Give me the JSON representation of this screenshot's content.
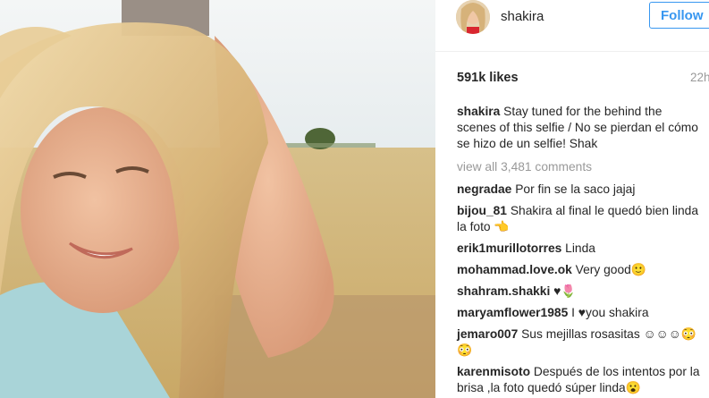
{
  "post": {
    "author": "shakira",
    "follow_label": "Follow",
    "likes": "591k likes",
    "time": "22h",
    "caption": {
      "user": "shakira",
      "text": "Stay tuned for the behind the scenes of this selfie / No se pierdan el cómo se hizo de un selfie! Shak"
    },
    "view_all": "view all 3,481 comments"
  },
  "comments": [
    {
      "user": "negradae",
      "text": "Por fin se la saco jajaj"
    },
    {
      "user": "bijou_81",
      "text": "Shakira al final le quedó bien linda la foto 👈"
    },
    {
      "user": "erik1murillotorres",
      "text": "Linda"
    },
    {
      "user": "mohammad.love.ok",
      "text": "Very good🙂"
    },
    {
      "user": "shahram.shakki",
      "text": "♥🌷"
    },
    {
      "user": "maryamflower1985",
      "text": "I ♥you shakira"
    },
    {
      "user": "jemaro007",
      "text": "Sus mejillas rosasitas ☺☺☺😳😳"
    },
    {
      "user": "karenmisoto",
      "text": "Después de los intentos por la brisa ,la foto quedó súper linda😮"
    }
  ]
}
